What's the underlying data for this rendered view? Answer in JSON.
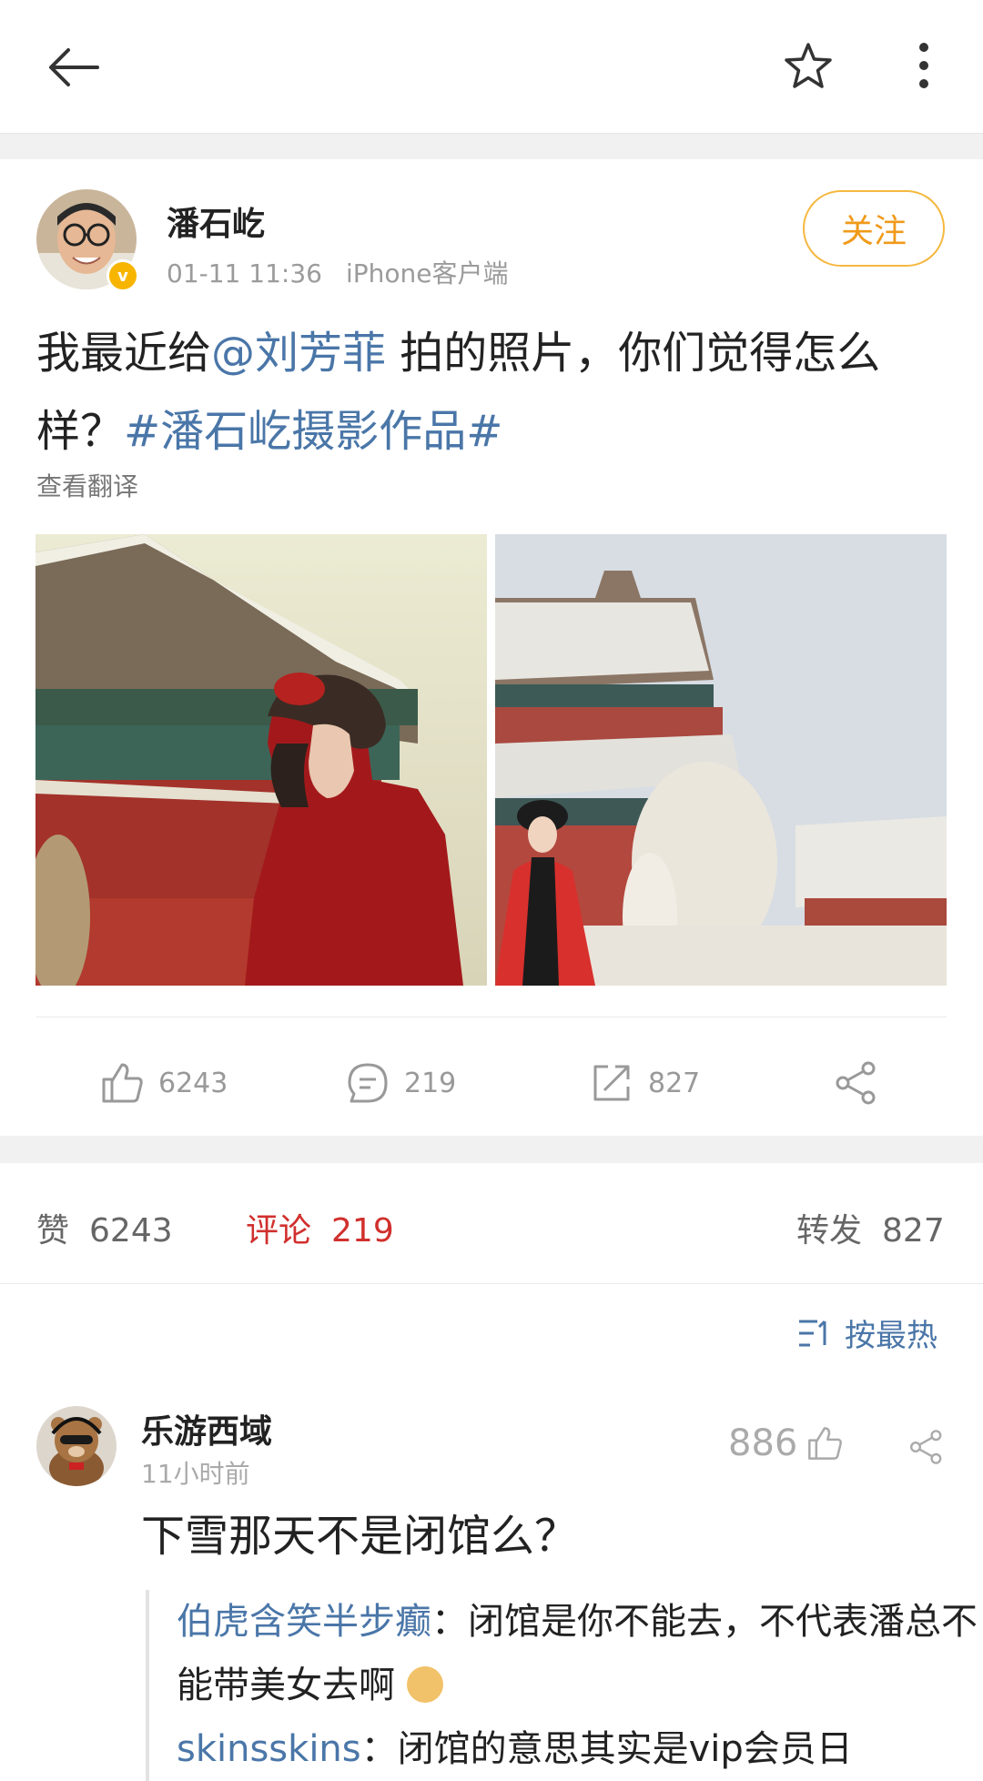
{
  "post": {
    "author": "潘石屹",
    "time": "01-11 11:36",
    "source": "iPhone客户端",
    "follow_label": "关注",
    "text_pre": "我最近给",
    "mention": "@刘芳菲",
    "text_mid": " 拍的照片，你们觉得怎么样？",
    "hashtag": "#潘石屹摄影作品#",
    "translate_label": "查看翻译",
    "likes": "6243",
    "comments": "219",
    "reposts": "827"
  },
  "stats": {
    "like_label": "赞",
    "like_count": "6243",
    "comment_label": "评论",
    "comment_count": "219",
    "repost_label": "转发",
    "repost_count": "827"
  },
  "sort_label": "按最热",
  "comment": {
    "author": "乐游西域",
    "time": "11小时前",
    "likes": "886",
    "text": "下雪那天不是闭馆么？",
    "replies": [
      {
        "name": "伯虎含笑半步癫",
        "text": "：闭馆是你不能去，不代表潘总不能带美女去啊"
      },
      {
        "name": "skinsskins",
        "text": "：闭馆的意思其实是vip会员日"
      }
    ]
  },
  "colors": {
    "link": "#4a76a8",
    "follow_border": "#f5b840",
    "follow_text": "#f09a1a",
    "active_tab": "#d0302d",
    "verified_badge": "#f7b500"
  }
}
